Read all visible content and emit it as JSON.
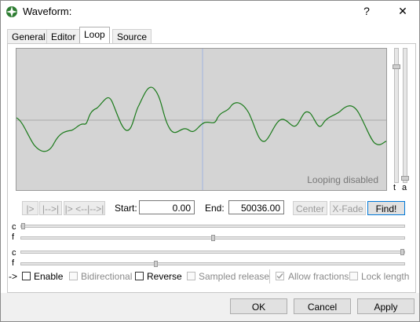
{
  "window": {
    "title": "Waveform:",
    "help": "?",
    "close": "✕"
  },
  "tabs": [
    {
      "label": "General"
    },
    {
      "label": "Editor"
    },
    {
      "label": "Loop",
      "active": true
    },
    {
      "label": "Source"
    }
  ],
  "waveform": {
    "status": "Looping disabled",
    "wave_color": "#1a7a1a",
    "background": "#d4d4d4"
  },
  "vsliders": {
    "t_label": "t",
    "a_label": "a"
  },
  "transport": {
    "play_loop": "|>",
    "loop": "|-->|",
    "play_xfade": "|> <--|-->|"
  },
  "start": {
    "label": "Start:",
    "value": "0.00"
  },
  "end": {
    "label": "End:",
    "value": "50036.00"
  },
  "buttons": {
    "center": "Center",
    "xfade": "X-Fade",
    "find": "Find!"
  },
  "sliders": {
    "c1": "c",
    "f1": "f",
    "c2": "c",
    "f2": "f",
    "start_coarse": 0.0,
    "start_fine": 0.5,
    "end_coarse": 1.0,
    "end_fine": 0.35
  },
  "options": {
    "arrow": "->",
    "enable": "Enable",
    "bidirectional": "Bidirectional",
    "reverse": "Reverse",
    "sampled_release": "Sampled release",
    "allow_fractions": "Allow fractions",
    "lock_length": "Lock length"
  },
  "dialog": {
    "ok": "OK",
    "cancel": "Cancel",
    "apply": "Apply"
  }
}
